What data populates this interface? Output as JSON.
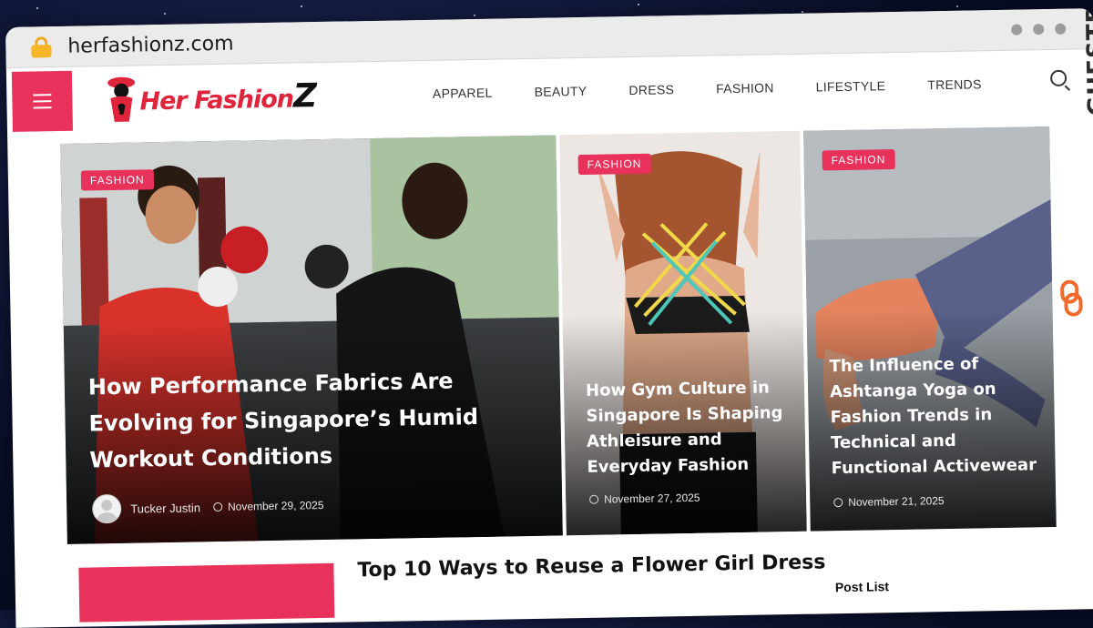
{
  "browser": {
    "url": "herfashionz.com"
  },
  "site": {
    "logo_text": "Her Fashion",
    "logo_z": "Z",
    "nav": [
      "APPAREL",
      "BEAUTY",
      "DRESS",
      "FASHION",
      "LIFESTYLE",
      "TRENDS"
    ]
  },
  "hero": [
    {
      "category": "FASHION",
      "title": "How Performance Fabrics Are Evolving for Singapore’s Humid Workout Conditions",
      "author": "Tucker Justin",
      "date": "November 29, 2025"
    },
    {
      "category": "FASHION",
      "title": "How Gym Culture in Singapore Is Shaping Athleisure and Everyday Fashion",
      "date": "November 27, 2025"
    },
    {
      "category": "FASHION",
      "title": "The Influence of Ashtanga Yoga on Fashion Trends in Technical and Functional Activewear",
      "date": "November 21, 2025"
    }
  ],
  "latest": {
    "title": "Top 10 Ways to Reuse a Flower Girl Dress",
    "sidebar_heading": "Post List"
  },
  "watermark": "GUESTPOSTLINKS",
  "colors": {
    "accent": "#e8315b",
    "logo_red": "#e0243b",
    "lock": "#f6b526",
    "watermark_orange": "#f26a2a"
  }
}
